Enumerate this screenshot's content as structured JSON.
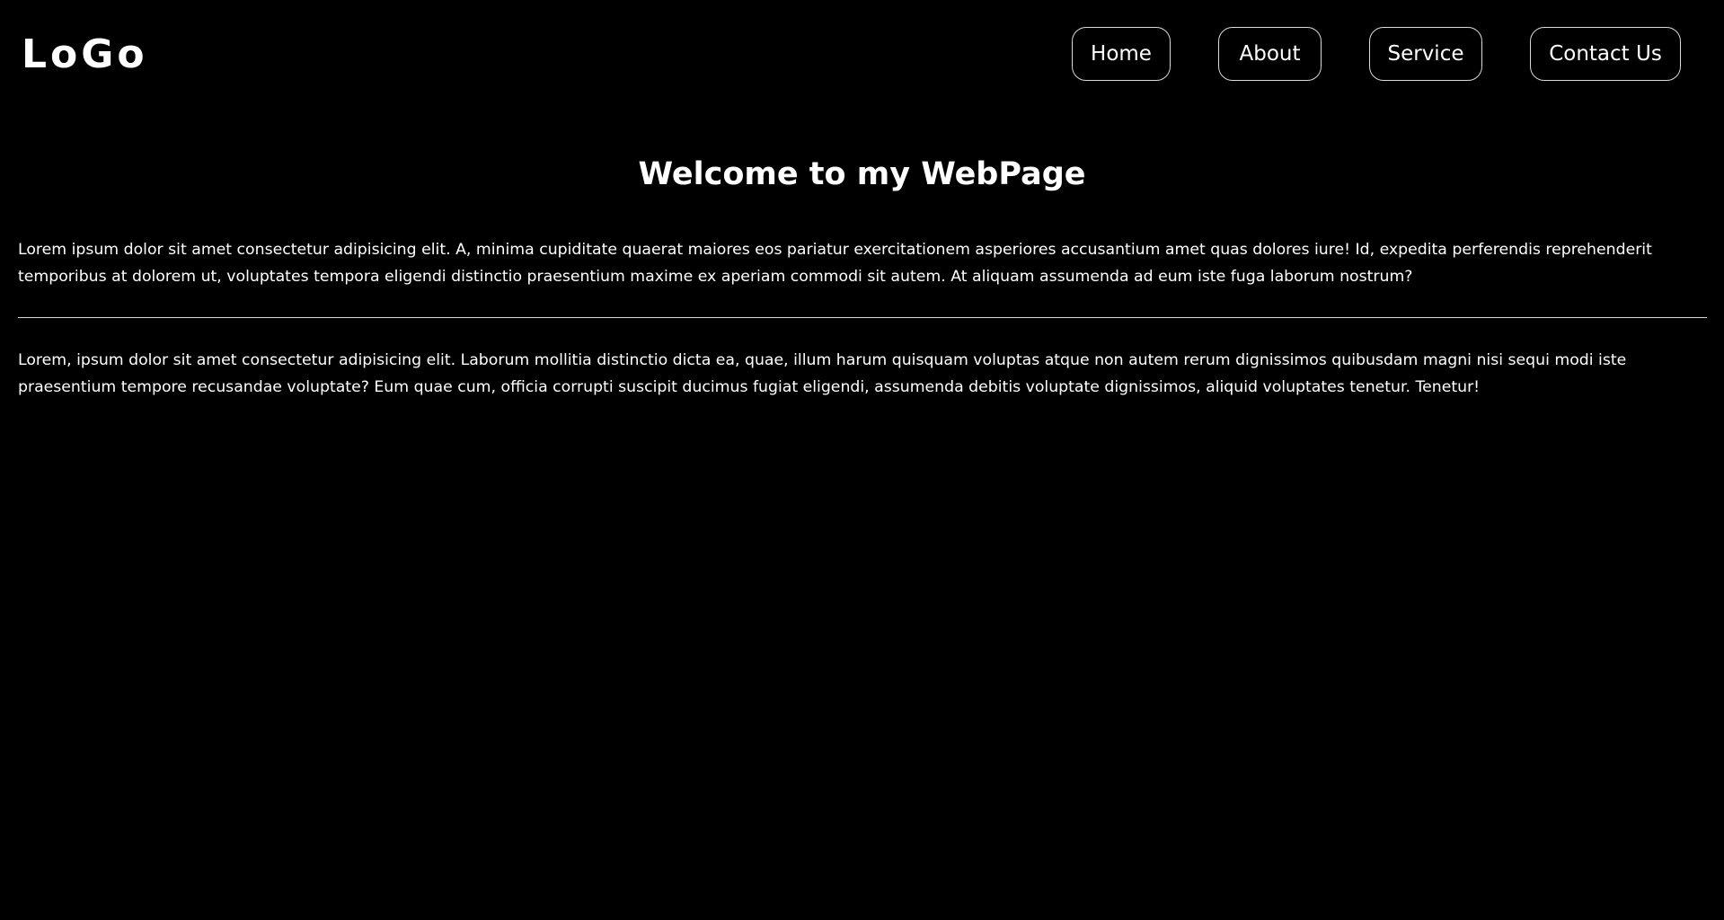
{
  "header": {
    "logo_text": "LoGo",
    "nav": {
      "home_label": "Home",
      "about_label": "About",
      "service_label": "Service",
      "contact_label": "Contact Us"
    }
  },
  "main": {
    "title": "Welcome to my WebPage",
    "paragraph_1": "Lorem ipsum dolor sit amet consectetur adipisicing elit. A, minima cupiditate quaerat maiores eos pariatur exercitationem asperiores accusantium amet quas dolores iure! Id, expedita perferendis reprehenderit temporibus at dolorem ut, voluptates tempora eligendi distinctio praesentium maxime ex aperiam commodi sit autem. At aliquam assumenda ad eum iste fuga laborum nostrum?",
    "paragraph_2": "Lorem, ipsum dolor sit amet consectetur adipisicing elit. Laborum mollitia distinctio dicta ea, quae, illum harum quisquam voluptas atque non autem rerum dignissimos quibusdam magni nisi sequi modi iste praesentium tempore recusandae voluptate? Eum quae cum, officia corrupti suscipit ducimus fugiat eligendi, assumenda debitis voluptate dignissimos, aliquid voluptates tenetur. Tenetur!"
  },
  "colors": {
    "background": "#000000",
    "text": "#ffffff",
    "border": "#d9d9d9"
  }
}
